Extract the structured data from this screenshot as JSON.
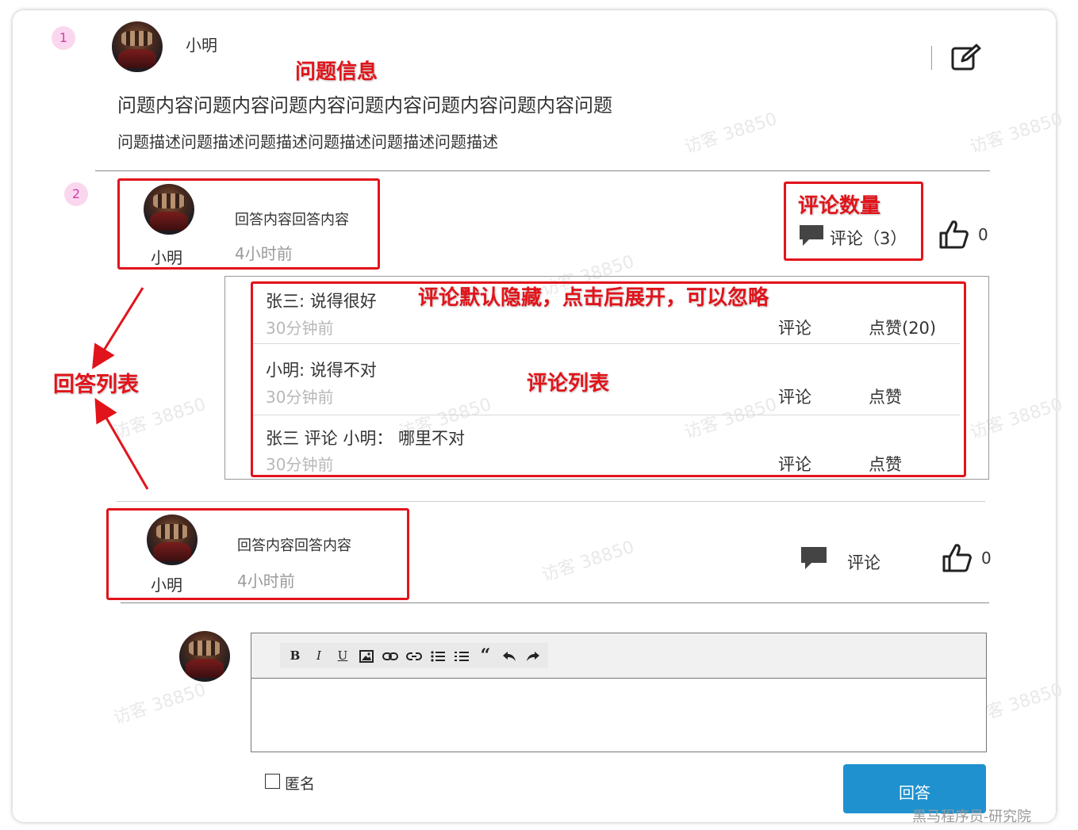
{
  "badges": [
    "1",
    "2"
  ],
  "watermark": "访客 38850",
  "question": {
    "author": "小明",
    "title": "问题内容问题内容问题内容问题内容问题内容问题内容问题",
    "description": "问题描述问题描述问题描述问题描述问题描述问题描述",
    "edit_icon": "edit-icon"
  },
  "annotations": {
    "question_info": "问题信息",
    "comment_count": "评论数量",
    "comments_hidden": "评论默认隐藏，点击后展开，可以忽略",
    "comment_list": "评论列表",
    "answer_list": "回答列表"
  },
  "answers": [
    {
      "author": "小明",
      "content": "回答内容回答内容",
      "time": "4小时前",
      "comment_label": "评论（3）",
      "like_count": "0"
    },
    {
      "author": "小明",
      "content": "回答内容回答内容",
      "time": "4小时前",
      "comment_label": "评论",
      "like_count": "0"
    }
  ],
  "comments": [
    {
      "text": "张三:  说得很好",
      "time": "30分钟前",
      "reply": "评论",
      "like": "点赞(20)"
    },
    {
      "text": "小明:  说得不对",
      "time": "30分钟前",
      "reply": "评论",
      "like": "点赞"
    },
    {
      "text": "张三 评论  小明：  哪里不对",
      "time": "30分钟前",
      "reply": "评论",
      "like": "点赞"
    }
  ],
  "editor": {
    "toolbar": [
      {
        "icon": "bold-icon",
        "glyph": "B"
      },
      {
        "icon": "italic-icon",
        "glyph": "I"
      },
      {
        "icon": "underline-icon",
        "glyph": "U"
      },
      {
        "icon": "image-icon",
        "glyph": ""
      },
      {
        "icon": "link-icon",
        "glyph": ""
      },
      {
        "icon": "unlink-icon",
        "glyph": ""
      },
      {
        "icon": "bullet-list-icon",
        "glyph": ""
      },
      {
        "icon": "numbered-list-icon",
        "glyph": ""
      },
      {
        "icon": "quote-icon",
        "glyph": "“"
      },
      {
        "icon": "undo-icon",
        "glyph": ""
      },
      {
        "icon": "redo-icon",
        "glyph": ""
      }
    ],
    "anonymous_label": "匿名",
    "anonymous_checked": false,
    "submit_label": "回答"
  },
  "footer_brand": "黑马程序员-研究院",
  "colors": {
    "annotation_red": "#e1141b",
    "submit_blue": "#1f91cf",
    "badge_bg": "#fbd7ef"
  }
}
